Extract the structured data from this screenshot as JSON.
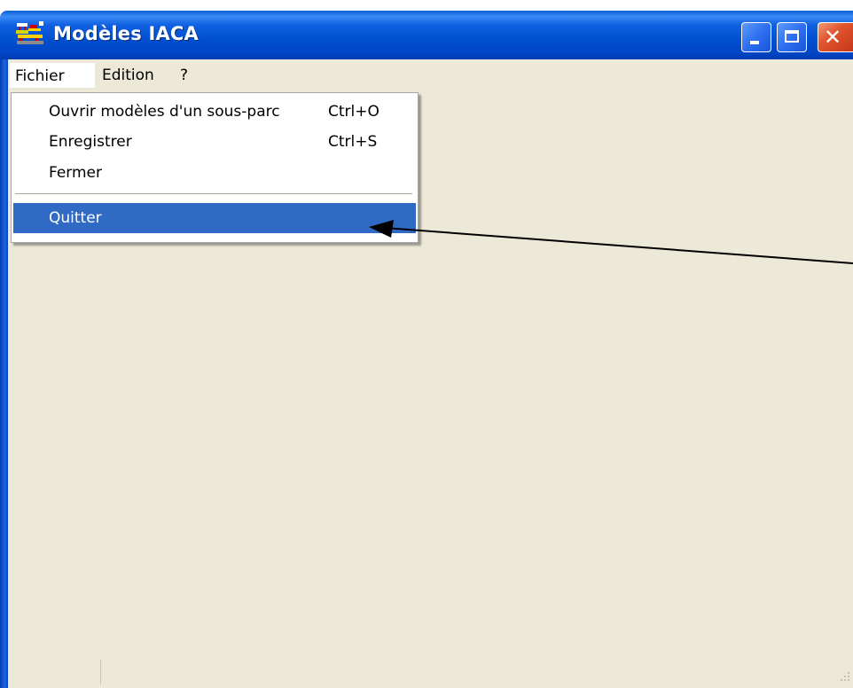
{
  "window": {
    "title": "Modèles IACA",
    "icon": "iaca-app-icon",
    "controls": {
      "minimize": "minimize-icon",
      "maximize": "maximize-icon",
      "close": "close-icon",
      "close_glyph": "✕"
    }
  },
  "menubar": {
    "items": [
      {
        "label": "Fichier",
        "state": "open"
      },
      {
        "label": "Edition"
      },
      {
        "label": "?"
      }
    ]
  },
  "file_menu": {
    "items": [
      {
        "label": "Ouvrir modèles d'un sous-parc",
        "shortcut": "Ctrl+O"
      },
      {
        "label": "Enregistrer",
        "shortcut": "Ctrl+S"
      },
      {
        "label": "Fermer",
        "shortcut": ""
      },
      {
        "label": "Quitter",
        "shortcut": "",
        "highlighted": true
      }
    ]
  },
  "colors": {
    "titlebar": "#0054e3",
    "highlight": "#316ac5",
    "client_background": "#ece9d8",
    "annotation_arrow": "#000000"
  }
}
